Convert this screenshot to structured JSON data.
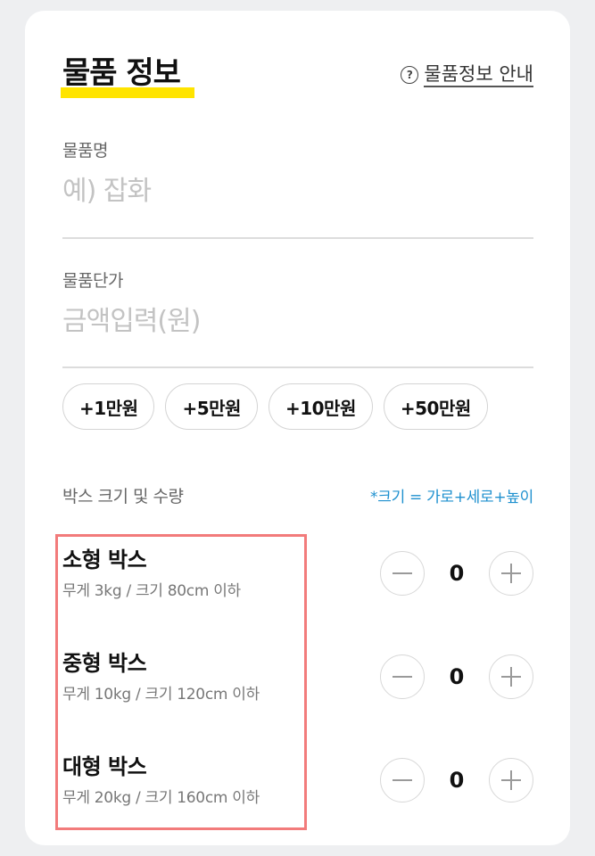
{
  "section": {
    "title": "물품 정보",
    "guide_link": "물품정보 안내",
    "guide_icon": "question-circle-icon"
  },
  "item_name": {
    "label": "물품명",
    "placeholder": "예) 잡화",
    "value": ""
  },
  "item_price": {
    "label": "물품단가",
    "placeholder": "금액입력(원)",
    "value": ""
  },
  "quick_amounts": [
    "+1만원",
    "+5만원",
    "+10만원",
    "+50만원"
  ],
  "boxes": {
    "label": "박스 크기 및 수량",
    "note": "*크기 = 가로+세로+높이",
    "items": [
      {
        "name": "소형 박스",
        "desc": "무게 3kg / 크기 80cm 이하",
        "qty": "0"
      },
      {
        "name": "중형 박스",
        "desc": "무게 10kg / 크기 120cm 이하",
        "qty": "0"
      },
      {
        "name": "대형 박스",
        "desc": "무게 20kg / 크기 160cm 이하",
        "qty": "0"
      }
    ]
  },
  "colors": {
    "title_highlight": "#ffe400",
    "note_blue": "#1e90cf",
    "selection_border": "#f27b7b"
  }
}
